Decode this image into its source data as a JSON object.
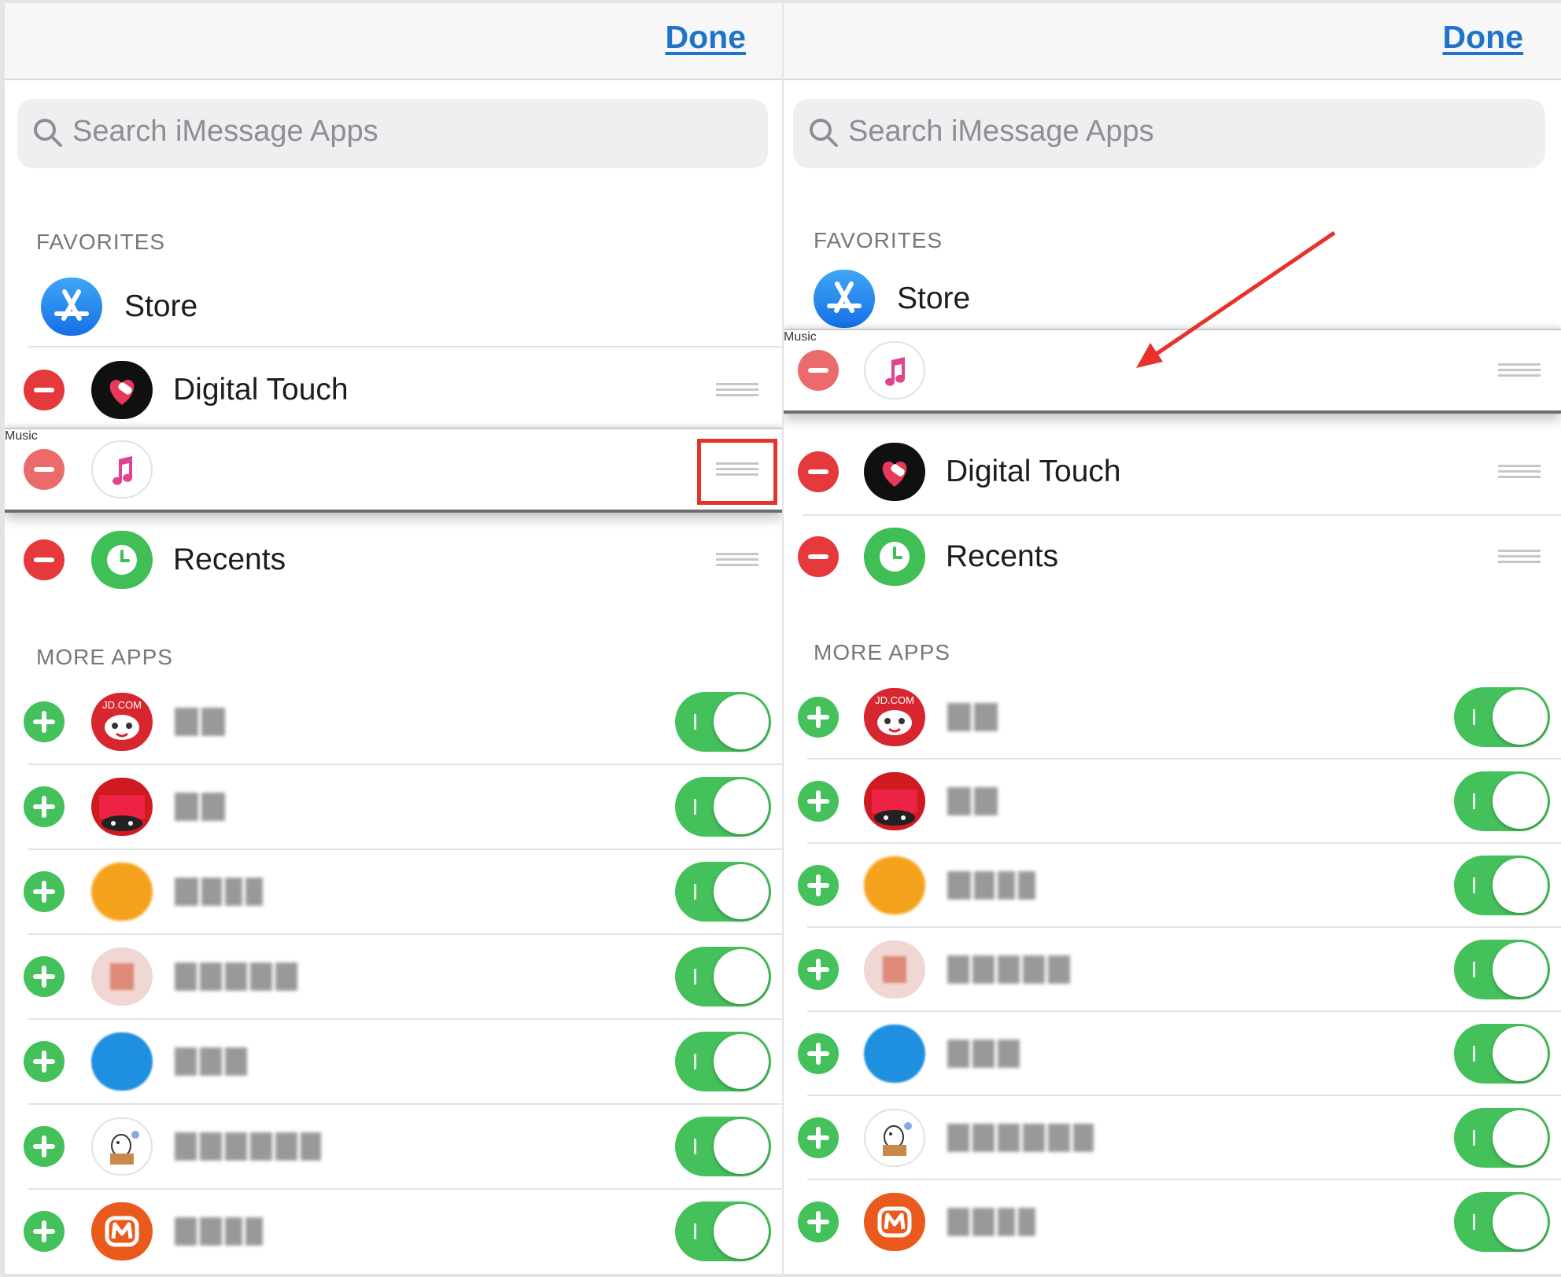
{
  "topbar": {
    "done_label": "Done"
  },
  "search": {
    "placeholder": "Search iMessage Apps"
  },
  "sections": {
    "favorites": "FAVORITES",
    "more_apps": "MORE APPS"
  },
  "left": {
    "favorites": [
      {
        "label": "Store",
        "icon": "app-store-icon"
      },
      {
        "label": "Digital Touch",
        "icon": "digital-touch-icon"
      },
      {
        "label": "Music",
        "icon": "music-icon"
      },
      {
        "label": "Recents",
        "icon": "recents-icon"
      }
    ]
  },
  "right": {
    "favorites": [
      {
        "label": "Store",
        "icon": "app-store-icon"
      },
      {
        "label": "Music",
        "icon": "music-icon"
      },
      {
        "label": "Digital Touch",
        "icon": "digital-touch-icon"
      },
      {
        "label": "Recents",
        "icon": "recents-icon"
      }
    ]
  },
  "more_apps": [
    {
      "icon": "jd-icon",
      "icon_text": "JD.COM",
      "enabled": true
    },
    {
      "icon": "tmall-icon",
      "enabled": true
    },
    {
      "icon": "orange-app-icon",
      "enabled": true
    },
    {
      "icon": "pink-app-icon",
      "enabled": true
    },
    {
      "icon": "blue-app-icon",
      "enabled": true
    },
    {
      "icon": "dog-app-icon",
      "enabled": true
    },
    {
      "icon": "mango-tv-icon",
      "enabled": true
    }
  ],
  "colors": {
    "accent": "#1f73c9",
    "delete": "#e5393c",
    "add": "#44c15b",
    "toggle_on": "#44c15b",
    "annotation": "#e8312a"
  }
}
